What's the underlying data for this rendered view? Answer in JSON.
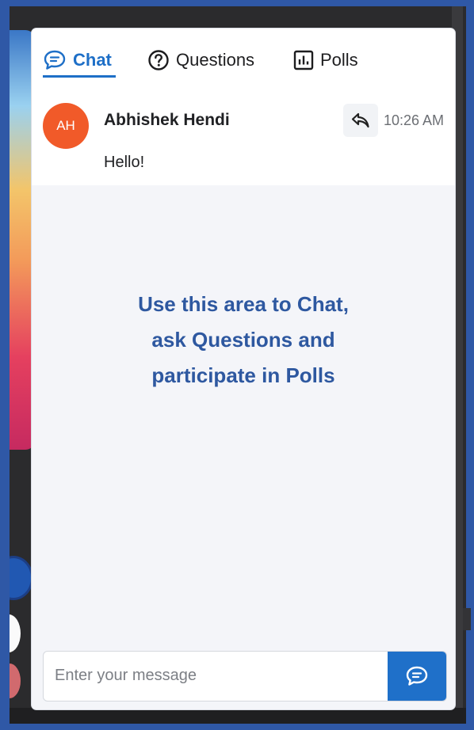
{
  "tabs": [
    {
      "label": "Chat",
      "icon": "chat-bubble-icon",
      "active": true
    },
    {
      "label": "Questions",
      "icon": "question-circle-icon",
      "active": false
    },
    {
      "label": "Polls",
      "icon": "bar-chart-icon",
      "active": false
    }
  ],
  "message": {
    "initials": "AH",
    "author": "Abhishek Hendi",
    "time": "10:26 AM",
    "text": "Hello!",
    "avatar_color": "#f15a29"
  },
  "hint": {
    "lines": [
      "Use this area to Chat,",
      "ask Questions and",
      "participate in Polls"
    ]
  },
  "composer": {
    "placeholder": "Enter your message",
    "value": ""
  },
  "colors": {
    "accent": "#1e6fc7",
    "hint_text": "#2e58a0",
    "frame": "#2f58a6"
  }
}
